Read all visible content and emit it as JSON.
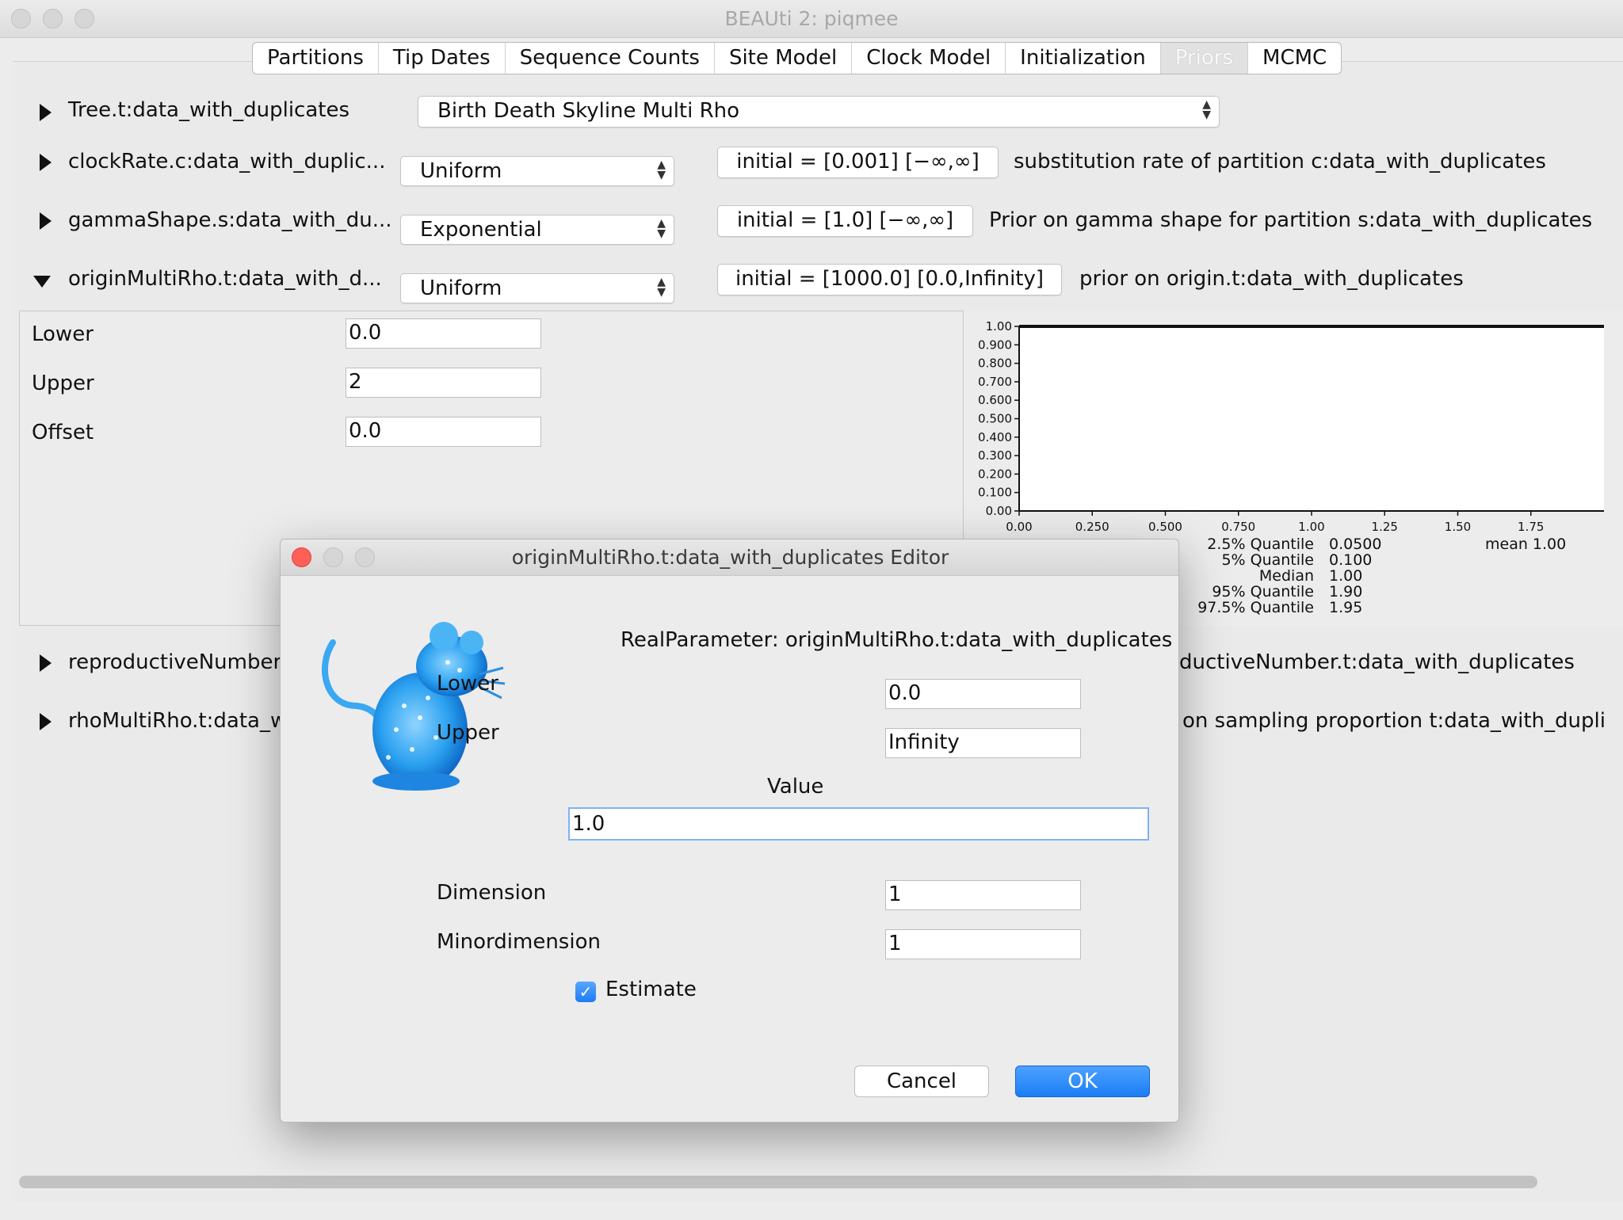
{
  "window": {
    "title": "BEAUti 2: piqmee"
  },
  "tabs": [
    "Partitions",
    "Tip Dates",
    "Sequence Counts",
    "Site Model",
    "Clock Model",
    "Initialization",
    "Priors",
    "MCMC"
  ],
  "selected_tab": "Priors",
  "priors": {
    "tree": {
      "label": "Tree.t:data_with_duplicates",
      "model": "Birth Death Skyline Multi Rho"
    },
    "clock": {
      "label": "clockRate.c:data_with_duplic...",
      "dist": "Uniform",
      "initial": "initial = [0.001] [−∞,∞]",
      "desc": "substitution rate of partition c:data_with_duplicates"
    },
    "gamma": {
      "label": "gammaShape.s:data_with_du...",
      "dist": "Exponential",
      "initial": "initial = [1.0] [−∞,∞]",
      "desc": "Prior on gamma shape for partition s:data_with_duplicates"
    },
    "origin": {
      "label": "originMultiRho.t:data_with_d...",
      "dist": "Uniform",
      "initial": "initial = [1000.0] [0.0,Infinity]",
      "desc": "prior on origin.t:data_with_duplicates"
    },
    "reproductive": {
      "label": "reproductiveNumberM",
      "desc": "ductiveNumber.t:data_with_duplicates"
    },
    "rho": {
      "label": "rhoMultiRho.t:data_w",
      "desc": "on sampling proportion t:data_with_duplic"
    }
  },
  "origin_params": {
    "lower_label": "Lower",
    "lower_value": "0.0",
    "upper_label": "Upper",
    "upper_value": "2",
    "offset_label": "Offset",
    "offset_value": "0.0"
  },
  "chart_data": {
    "type": "line",
    "x_ticks": [
      "0.00",
      "0.250",
      "0.500",
      "0.750",
      "1.00",
      "1.25",
      "1.50",
      "1.75"
    ],
    "y_ticks": [
      "0.00",
      "0.100",
      "0.200",
      "0.300",
      "0.400",
      "0.500",
      "0.600",
      "0.700",
      "0.800",
      "0.900",
      "1.00"
    ],
    "xlim": [
      0,
      2
    ],
    "ylim": [
      0,
      1
    ],
    "series": [
      {
        "x": [
          0,
          2
        ],
        "y": [
          1,
          1
        ]
      }
    ],
    "stats": [
      {
        "label": "2.5% Quantile",
        "value": "0.0500"
      },
      {
        "label": "5% Quantile",
        "value": "0.100"
      },
      {
        "label": "Median",
        "value": "1.00"
      },
      {
        "label": "95% Quantile",
        "value": "1.90"
      },
      {
        "label": "97.5% Quantile",
        "value": "1.95"
      }
    ],
    "mean": "mean 1.00"
  },
  "dialog": {
    "title": "originMultiRho.t:data_with_duplicates Editor",
    "heading": "RealParameter: originMultiRho.t:data_with_duplicates",
    "lower_label": "Lower",
    "lower_value": "0.0",
    "upper_label": "Upper",
    "upper_value": "Infinity",
    "value_label": "Value",
    "value_value": "1.0",
    "dimension_label": "Dimension",
    "dimension_value": "1",
    "minordimension_label": "Minordimension",
    "minordimension_value": "1",
    "estimate_label": "Estimate",
    "estimate_checked": true,
    "cancel_label": "Cancel",
    "ok_label": "OK",
    "accent_color": "#1a7ef5"
  }
}
